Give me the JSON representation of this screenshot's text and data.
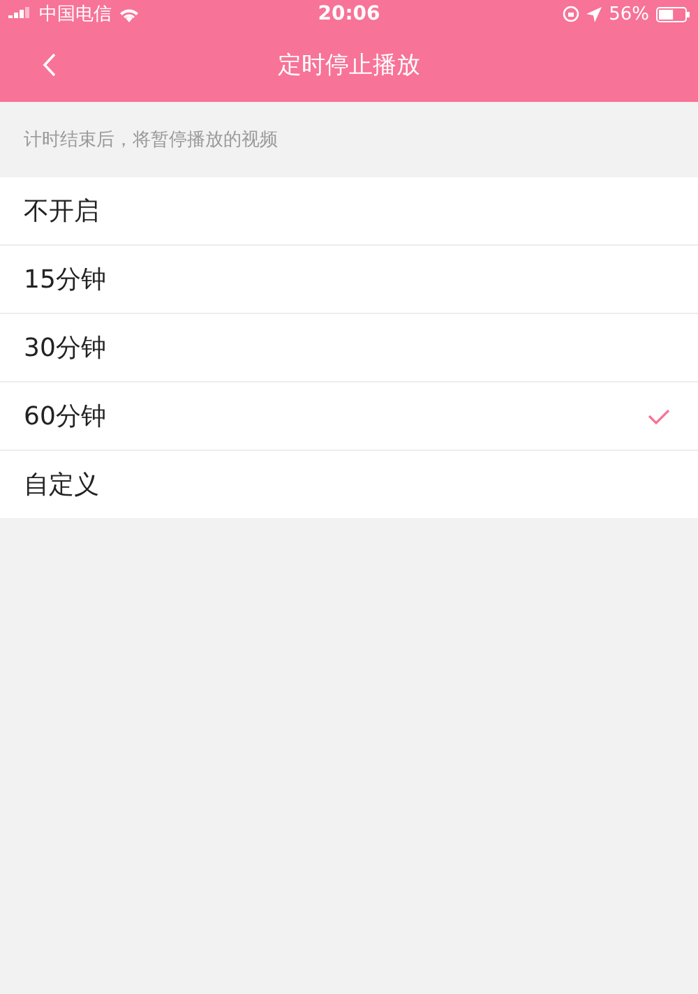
{
  "status_bar": {
    "carrier": "中国电信",
    "time": "20:06",
    "battery": "56%"
  },
  "nav_bar": {
    "title": "定时停止播放"
  },
  "hint": "计时结束后，将暂停播放的视频",
  "options": [
    {
      "label": "不开启",
      "selected": false
    },
    {
      "label": "15分钟",
      "selected": false
    },
    {
      "label": "30分钟",
      "selected": false
    },
    {
      "label": "60分钟",
      "selected": true
    },
    {
      "label": "自定义",
      "selected": false
    }
  ]
}
